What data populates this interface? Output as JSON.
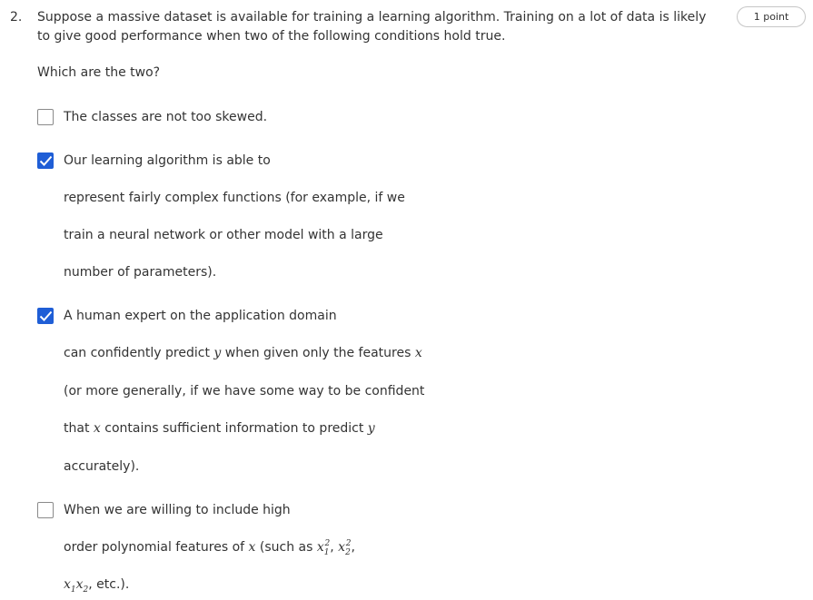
{
  "question": {
    "number": "2.",
    "text": "Suppose a massive dataset is available for training a learning algorithm. Training on a lot of data is likely to give good performance when two of the following conditions hold true.",
    "subtext": "Which are the two?",
    "points_label": "1 point"
  },
  "options": [
    {
      "checked": false,
      "line1": "The classes are not too skewed."
    },
    {
      "checked": true,
      "line1": "Our learning algorithm is able to",
      "line2": "represent fairly complex functions (for example, if we",
      "line3": "train a neural network or other model with a large",
      "line4": "number of parameters)."
    },
    {
      "checked": true,
      "line1": "A human expert on the application domain",
      "line2_pre": "can confidently predict",
      "line2_mid": "when given only the features",
      "line3": "(or more generally, if we have some way to be confident",
      "line4_pre": "that",
      "line4_mid": "contains sufficient information to predict",
      "line5": "accurately)."
    },
    {
      "checked": false,
      "line1": "When we are willing to include high",
      "line2_pre": "order polynomial features of",
      "line2_mid": "(such as",
      "line3_post": ", etc.)."
    }
  ],
  "math": {
    "x": "x",
    "y": "y",
    "one": "1",
    "two": "2",
    "sep": ",",
    "sp": " "
  },
  "colors": {
    "accent": "#1f5ed6",
    "text": "#333333",
    "checkbox_border": "#8a8a8a"
  },
  "icons": {
    "checkmark": "check-icon"
  }
}
